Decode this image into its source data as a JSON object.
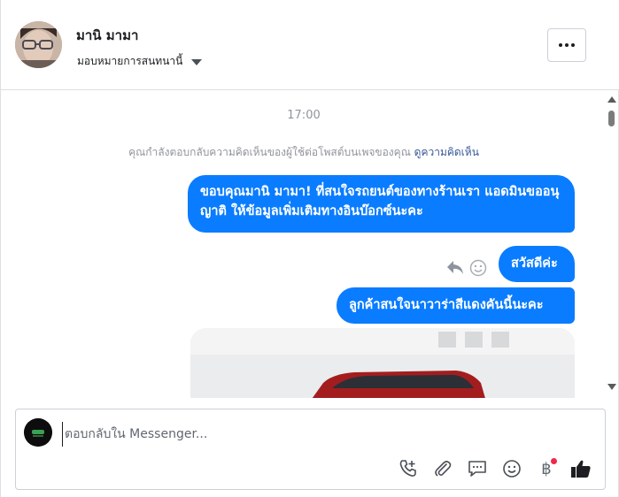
{
  "header": {
    "contact_name": "มานิ มามา",
    "assign_label": "มอบหมายการสนทนานี้",
    "more_label": "More"
  },
  "conversation": {
    "time": "17:00",
    "notice_text": "คุณกำลังตอบกลับความคิดเห็นของผู้ใช้ต่อโพสต์บนเพจของคุณ",
    "notice_link": "ดูความคิดเห็น",
    "messages": [
      {
        "text": "ขอบคุณมานิ มามา! ที่สนใจรถยนต์ของทางร้านเรา แอดมินขออนุญาติ ให้ข้อมูลเพิ่มเติมทางอินบ๊อกซ์นะคะ"
      },
      {
        "text": "สวัสดีค่ะ"
      },
      {
        "text": "ลูกค้าสนใจนาวาร่าสีแดงคันนี้นะคะ"
      }
    ]
  },
  "composer": {
    "placeholder": "ตอบกลับใน Messenger...",
    "baht_symbol": "฿"
  },
  "colors": {
    "bubble": "#0a7cff",
    "link": "#385898",
    "notification_dot": "#f0284a"
  },
  "icons": [
    "caret-down-icon",
    "more-icon",
    "reply-icon",
    "emoji-icon",
    "call-add-icon",
    "attachment-icon",
    "saved-reply-icon",
    "emoji-icon",
    "baht-icon",
    "like-icon"
  ]
}
